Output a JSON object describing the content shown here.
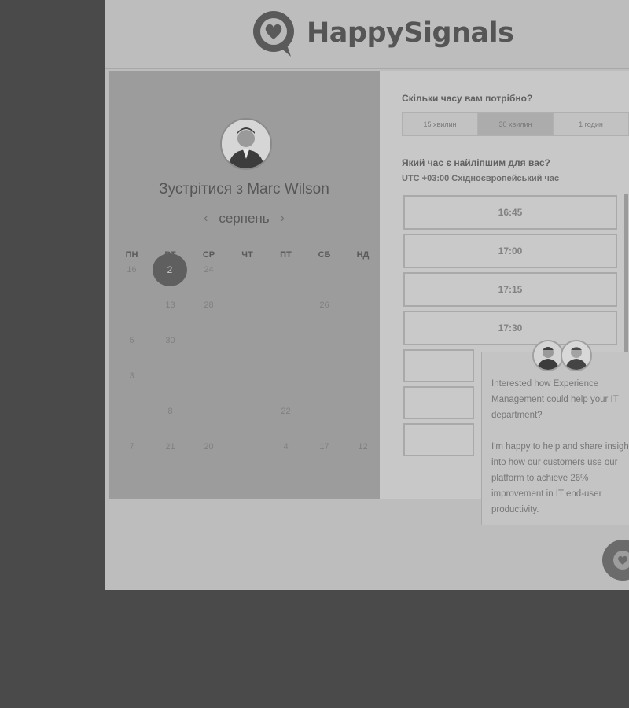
{
  "brand": {
    "name": "HappySignals"
  },
  "calendar": {
    "title": "Зустрітися з Marc Wilson",
    "month": "серпень",
    "prev_icon": "‹",
    "next_icon": "›",
    "weekdays": [
      "ПН",
      "ВТ",
      "СР",
      "ЧТ",
      "ПТ",
      "СБ",
      "НД"
    ],
    "days": [
      "16",
      "2",
      "24",
      "",
      "",
      "",
      "",
      "",
      "13",
      "28",
      "",
      "",
      "26",
      "",
      "5",
      "30",
      "",
      "",
      "",
      "",
      "",
      "3",
      "",
      "",
      "",
      "",
      "",
      "",
      "",
      "8",
      "",
      "",
      "22",
      "",
      "",
      "7",
      "21",
      "20",
      "",
      "4",
      "17",
      "12"
    ],
    "selected_day": "2"
  },
  "booking": {
    "duration_question": "Скільки часу вам потрібно?",
    "durations": [
      "15 хвилин",
      "30 хвилин",
      "1 годин"
    ],
    "active_duration": 1,
    "time_question": "Який час є найліпшим для вас?",
    "timezone": "UTC +03:00 Східноєвропейський час",
    "slots": [
      "16:45",
      "17:00",
      "17:15",
      "17:30"
    ]
  },
  "chat": {
    "message_1": "Interested how Experience Management could help your IT department?",
    "message_2": "I'm happy to help and share insight into how our customers use our platform to achieve 26% improvement in IT end-user productivity."
  },
  "icons": {
    "logo": "heart-speech-bubble-icon",
    "chat_fab": "chat-icon"
  },
  "colors": {
    "brand_gray": "#555555",
    "selected_day": "#5f5f5f"
  }
}
